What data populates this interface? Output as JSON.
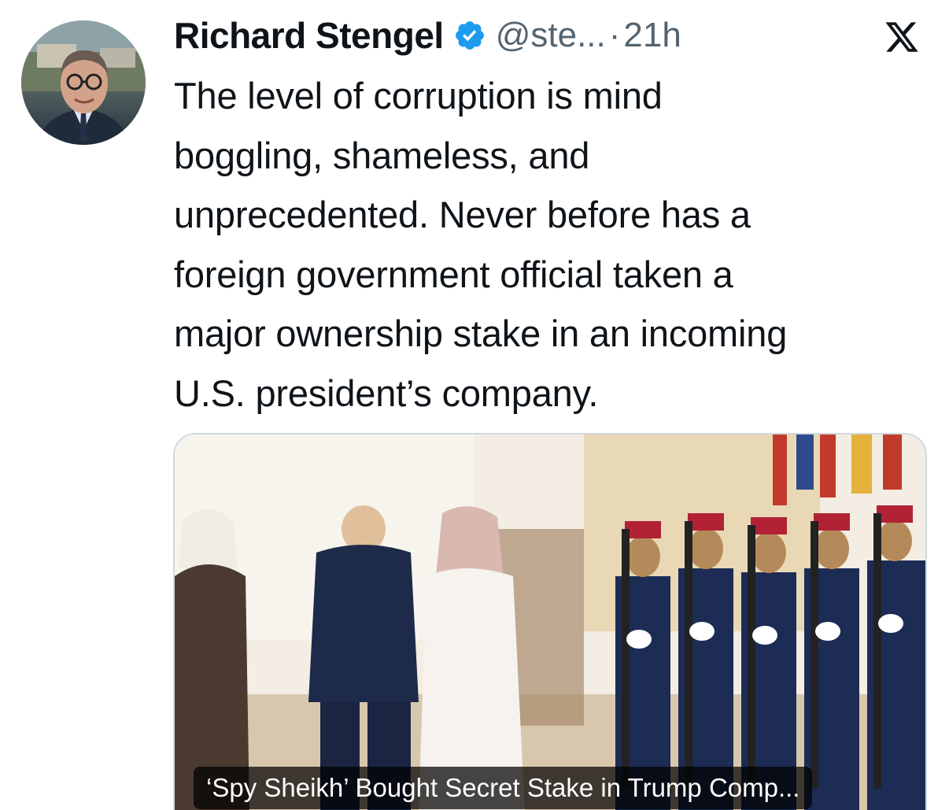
{
  "tweet": {
    "author_name": "Richard Stengel",
    "verified_icon": "verified-badge-icon",
    "handle": "@ste...",
    "separator": "·",
    "time": "21h",
    "text": "The level of corruption is mind\nboggling, shameless, and\nunprecedented. Never before has a\nforeign government official taken a\nmajor ownership stake in an incoming\nU.S. president’s company."
  },
  "media": {
    "caption": "‘Spy Sheikh’ Bought Secret Stake in Trump Comp..."
  },
  "icons": {
    "platform": "x-logo-icon",
    "avatar": "avatar-photo"
  },
  "colors": {
    "verified": "#1d9bf0",
    "secondary_text": "#536471",
    "primary_text": "#0f1419"
  }
}
